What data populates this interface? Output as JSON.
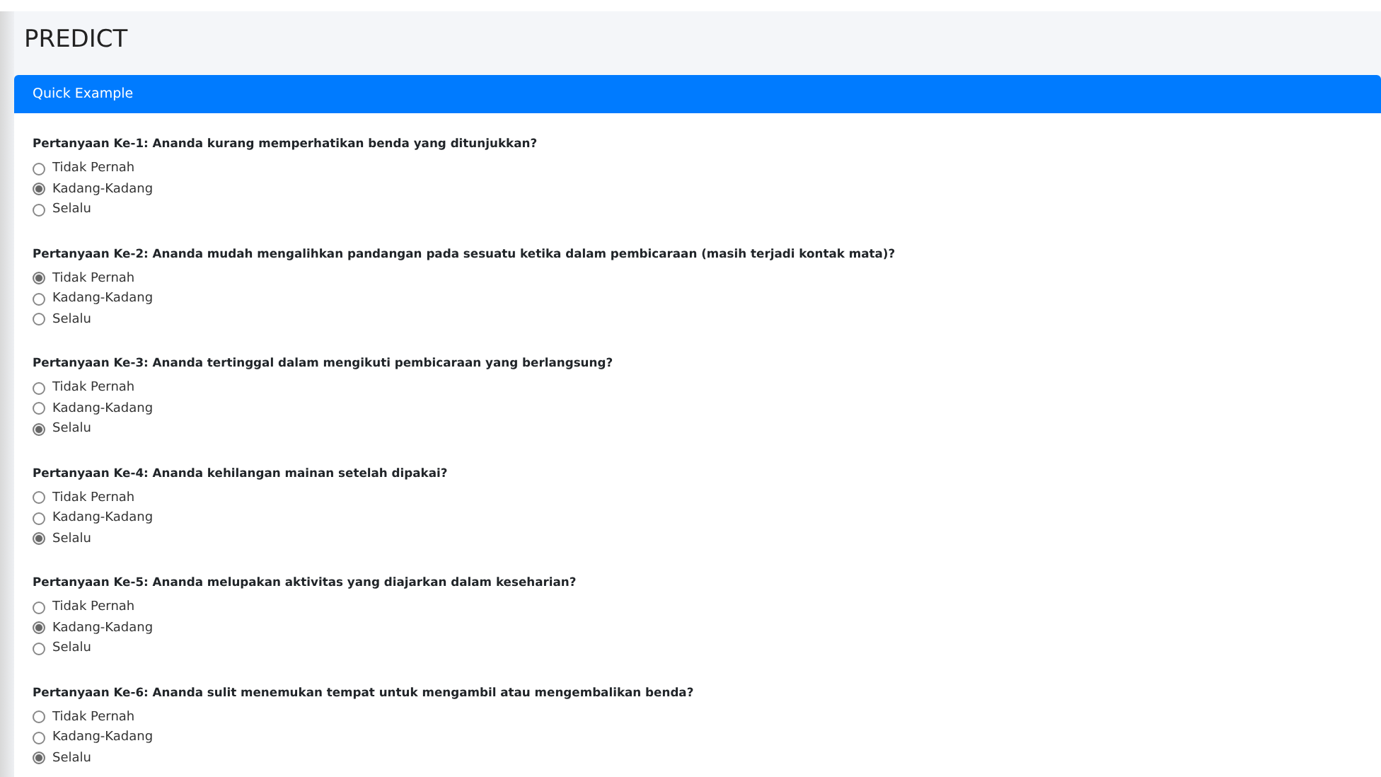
{
  "page": {
    "title": "PREDICT"
  },
  "card": {
    "title": "Quick Example"
  },
  "questions": [
    {
      "text": "Pertanyaan Ke-1: Ananda kurang memperhatikan benda yang ditunjukkan?",
      "options": [
        {
          "label": "Tidak Pernah",
          "selected": false
        },
        {
          "label": "Kadang-Kadang",
          "selected": true
        },
        {
          "label": "Selalu",
          "selected": false
        }
      ]
    },
    {
      "text": "Pertanyaan Ke-2: Ananda mudah mengalihkan pandangan pada sesuatu ketika dalam pembicaraan (masih terjadi kontak mata)?",
      "options": [
        {
          "label": "Tidak Pernah",
          "selected": true
        },
        {
          "label": "Kadang-Kadang",
          "selected": false
        },
        {
          "label": "Selalu",
          "selected": false
        }
      ]
    },
    {
      "text": "Pertanyaan Ke-3: Ananda tertinggal dalam mengikuti pembicaraan yang berlangsung?",
      "options": [
        {
          "label": "Tidak Pernah",
          "selected": false
        },
        {
          "label": "Kadang-Kadang",
          "selected": false
        },
        {
          "label": "Selalu",
          "selected": true
        }
      ]
    },
    {
      "text": "Pertanyaan Ke-4: Ananda kehilangan mainan setelah dipakai?",
      "options": [
        {
          "label": "Tidak Pernah",
          "selected": false
        },
        {
          "label": "Kadang-Kadang",
          "selected": false
        },
        {
          "label": "Selalu",
          "selected": true
        }
      ]
    },
    {
      "text": "Pertanyaan Ke-5: Ananda melupakan aktivitas yang diajarkan dalam keseharian?",
      "options": [
        {
          "label": "Tidak Pernah",
          "selected": false
        },
        {
          "label": "Kadang-Kadang",
          "selected": true
        },
        {
          "label": "Selalu",
          "selected": false
        }
      ]
    },
    {
      "text": "Pertanyaan Ke-6: Ananda sulit menemukan tempat untuk mengambil atau mengembalikan benda?",
      "options": [
        {
          "label": "Tidak Pernah",
          "selected": false
        },
        {
          "label": "Kadang-Kadang",
          "selected": false
        },
        {
          "label": "Selalu",
          "selected": true
        }
      ]
    }
  ]
}
